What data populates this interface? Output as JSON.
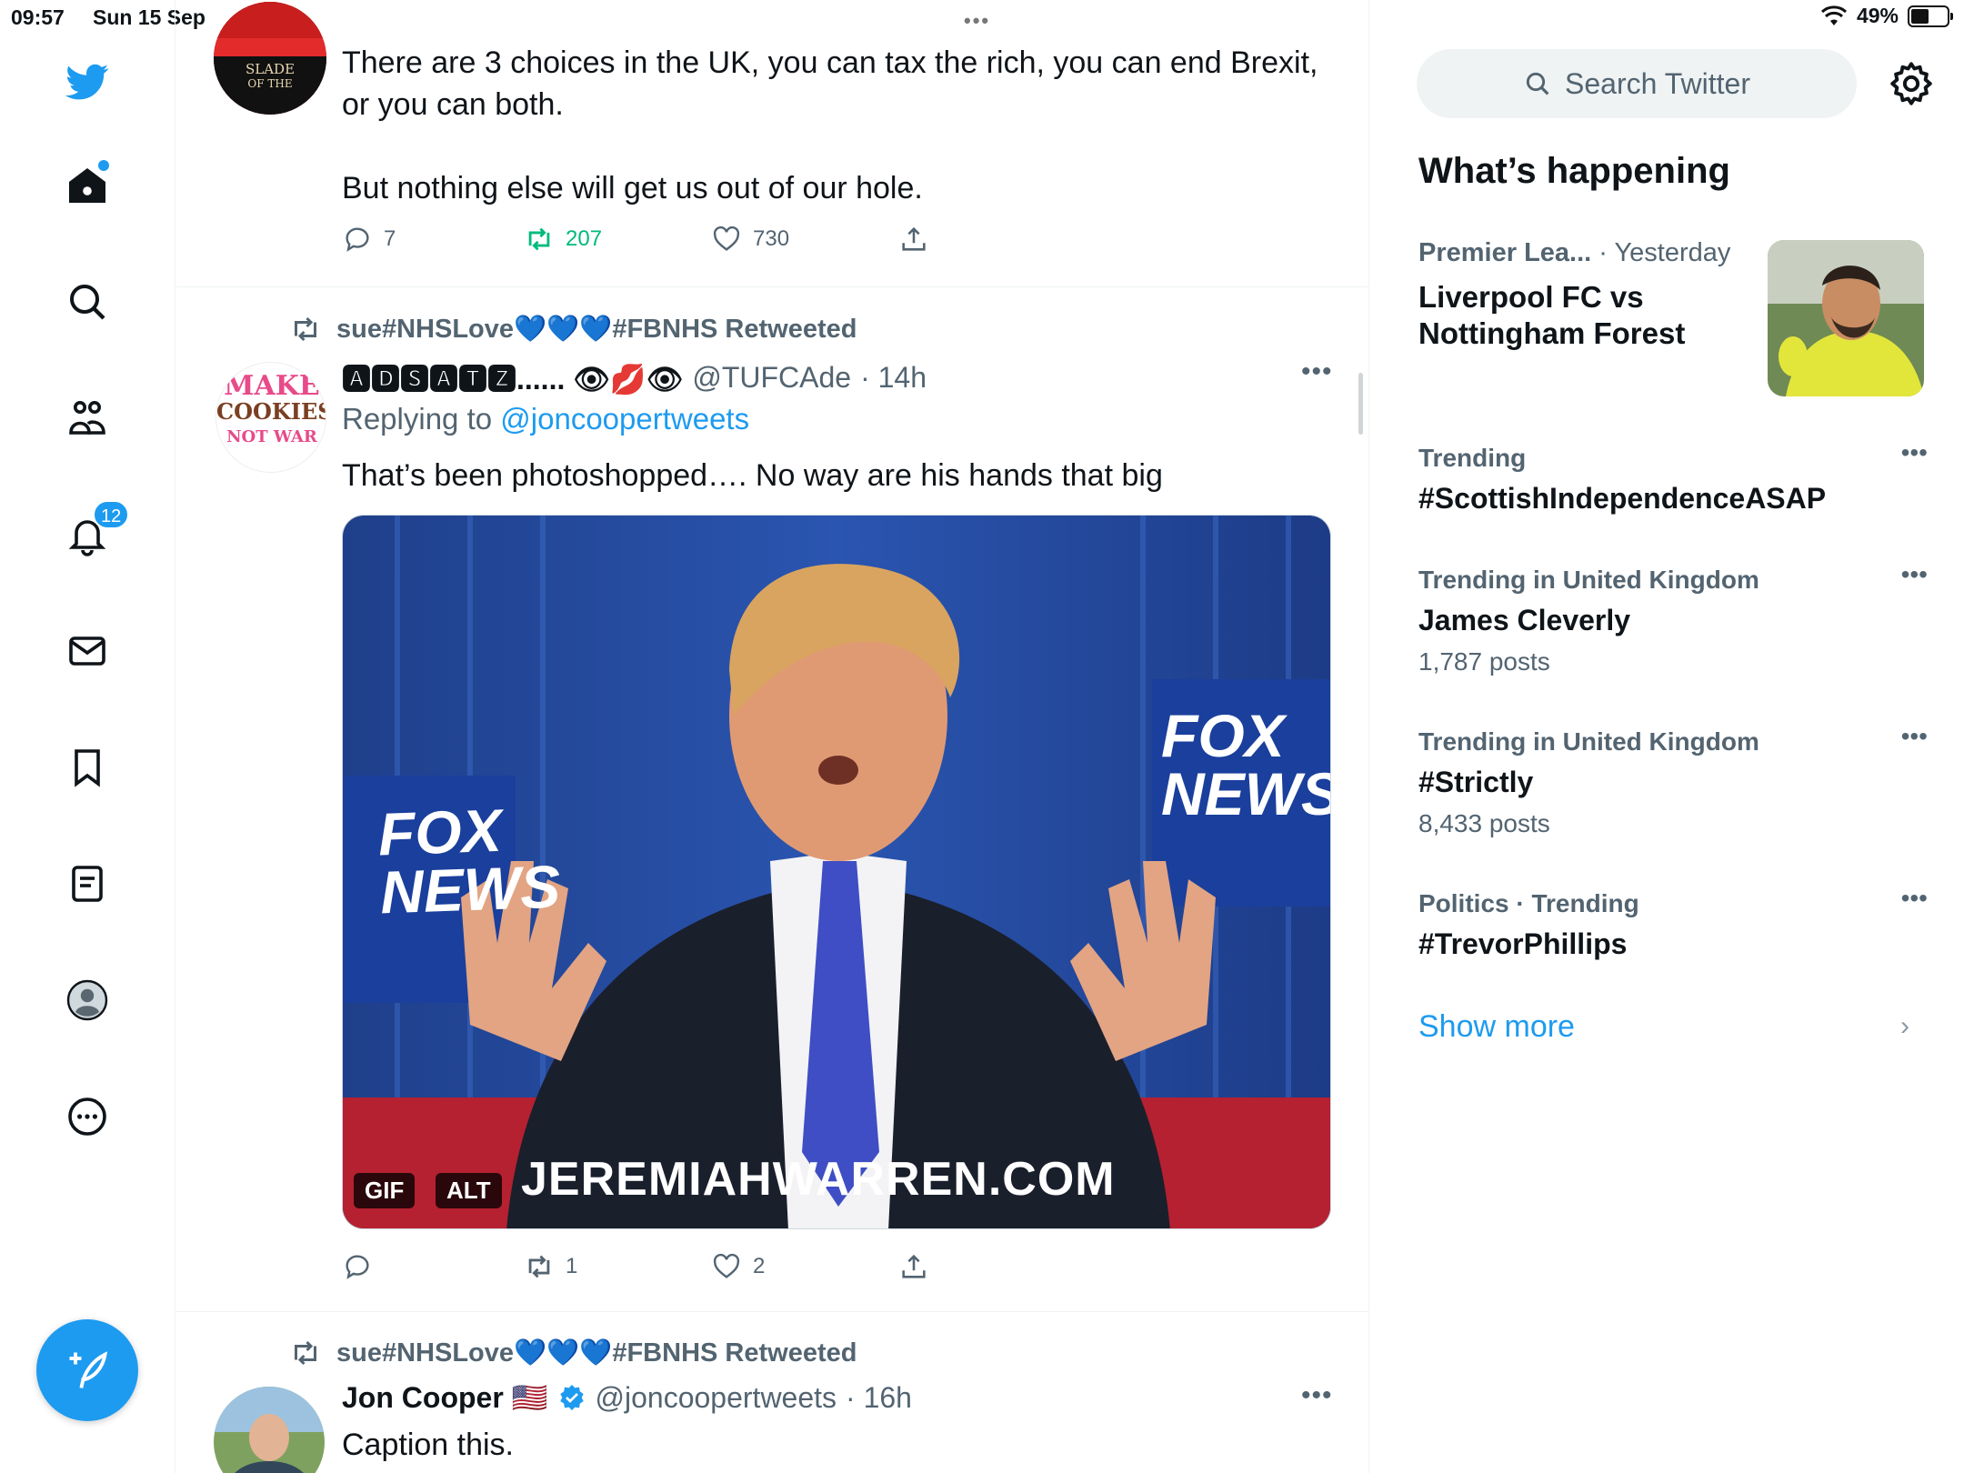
{
  "status_bar": {
    "time": "09:57",
    "date": "Sun 15 Sep",
    "multitask_dots": "•••",
    "battery_percent": "49%",
    "battery_level": 0.49
  },
  "nav": {
    "notifications_badge": "12"
  },
  "timeline": {
    "tweet1": {
      "text_line1": "There are 3 choices in the UK, you can tax the rich, you can end Brexit,",
      "text_line2": "or you can both.",
      "text_line3": "But nothing else will get us out of our hole.",
      "avatar_text_line1": "SLADE",
      "avatar_text_line2": "OF THE",
      "replies": "7",
      "retweets": "207",
      "likes": "730"
    },
    "tweet2": {
      "retweeted_by": "sue#NHSLove💙💙💙#FBNHS Retweeted",
      "display_name": "🅰🅳🆂🅰🆃🆉...... 👁💋👁",
      "handle": "@TUFCAde",
      "time": "· 14h",
      "replying_prefix": "Replying to",
      "replying_handle": "@joncoopertweets",
      "text": "That’s been photoshopped…. No way are his hands that big",
      "avatar_text_line1": "MAKE",
      "avatar_text_line2": "COOKIES",
      "avatar_text_line3": "NOT WAR",
      "media_caption": "JEREMIAHWARREN.COM",
      "media_logo_top": "FOX",
      "media_logo_bottom": "NEWS",
      "media_gif_tag": "GIF",
      "media_alt_tag": "ALT",
      "replies": "",
      "retweets": "1",
      "likes": "2"
    },
    "tweet3": {
      "retweeted_by": "sue#NHSLove💙💙💙#FBNHS Retweeted",
      "display_name": "Jon Cooper 🇺🇸",
      "handle": "@joncoopertweets",
      "time": "· 16h",
      "text": "Caption this."
    }
  },
  "sidebar": {
    "search_placeholder": "Search Twitter",
    "section_title": "What’s happening",
    "featured": {
      "category": "Premier Lea...",
      "time": "· Yesterday",
      "title_line1": "Liverpool FC vs",
      "title_line2": "Nottingham Forest"
    },
    "trends": [
      {
        "context": "Trending",
        "name": "#ScottishIndependenceASAP",
        "count": ""
      },
      {
        "context": "Trending in United Kingdom",
        "name": "James Cleverly",
        "count": "1,787 posts"
      },
      {
        "context": "Trending in United Kingdom",
        "name": "#Strictly",
        "count": "8,433 posts"
      },
      {
        "context": "Politics · Trending",
        "name": "#TrevorPhillips",
        "count": ""
      }
    ],
    "show_more": "Show more"
  },
  "colors": {
    "accent": "#1d9bf0",
    "retweet_active": "#00ba7c",
    "muted_text": "#536471",
    "border": "#eff3f4"
  }
}
